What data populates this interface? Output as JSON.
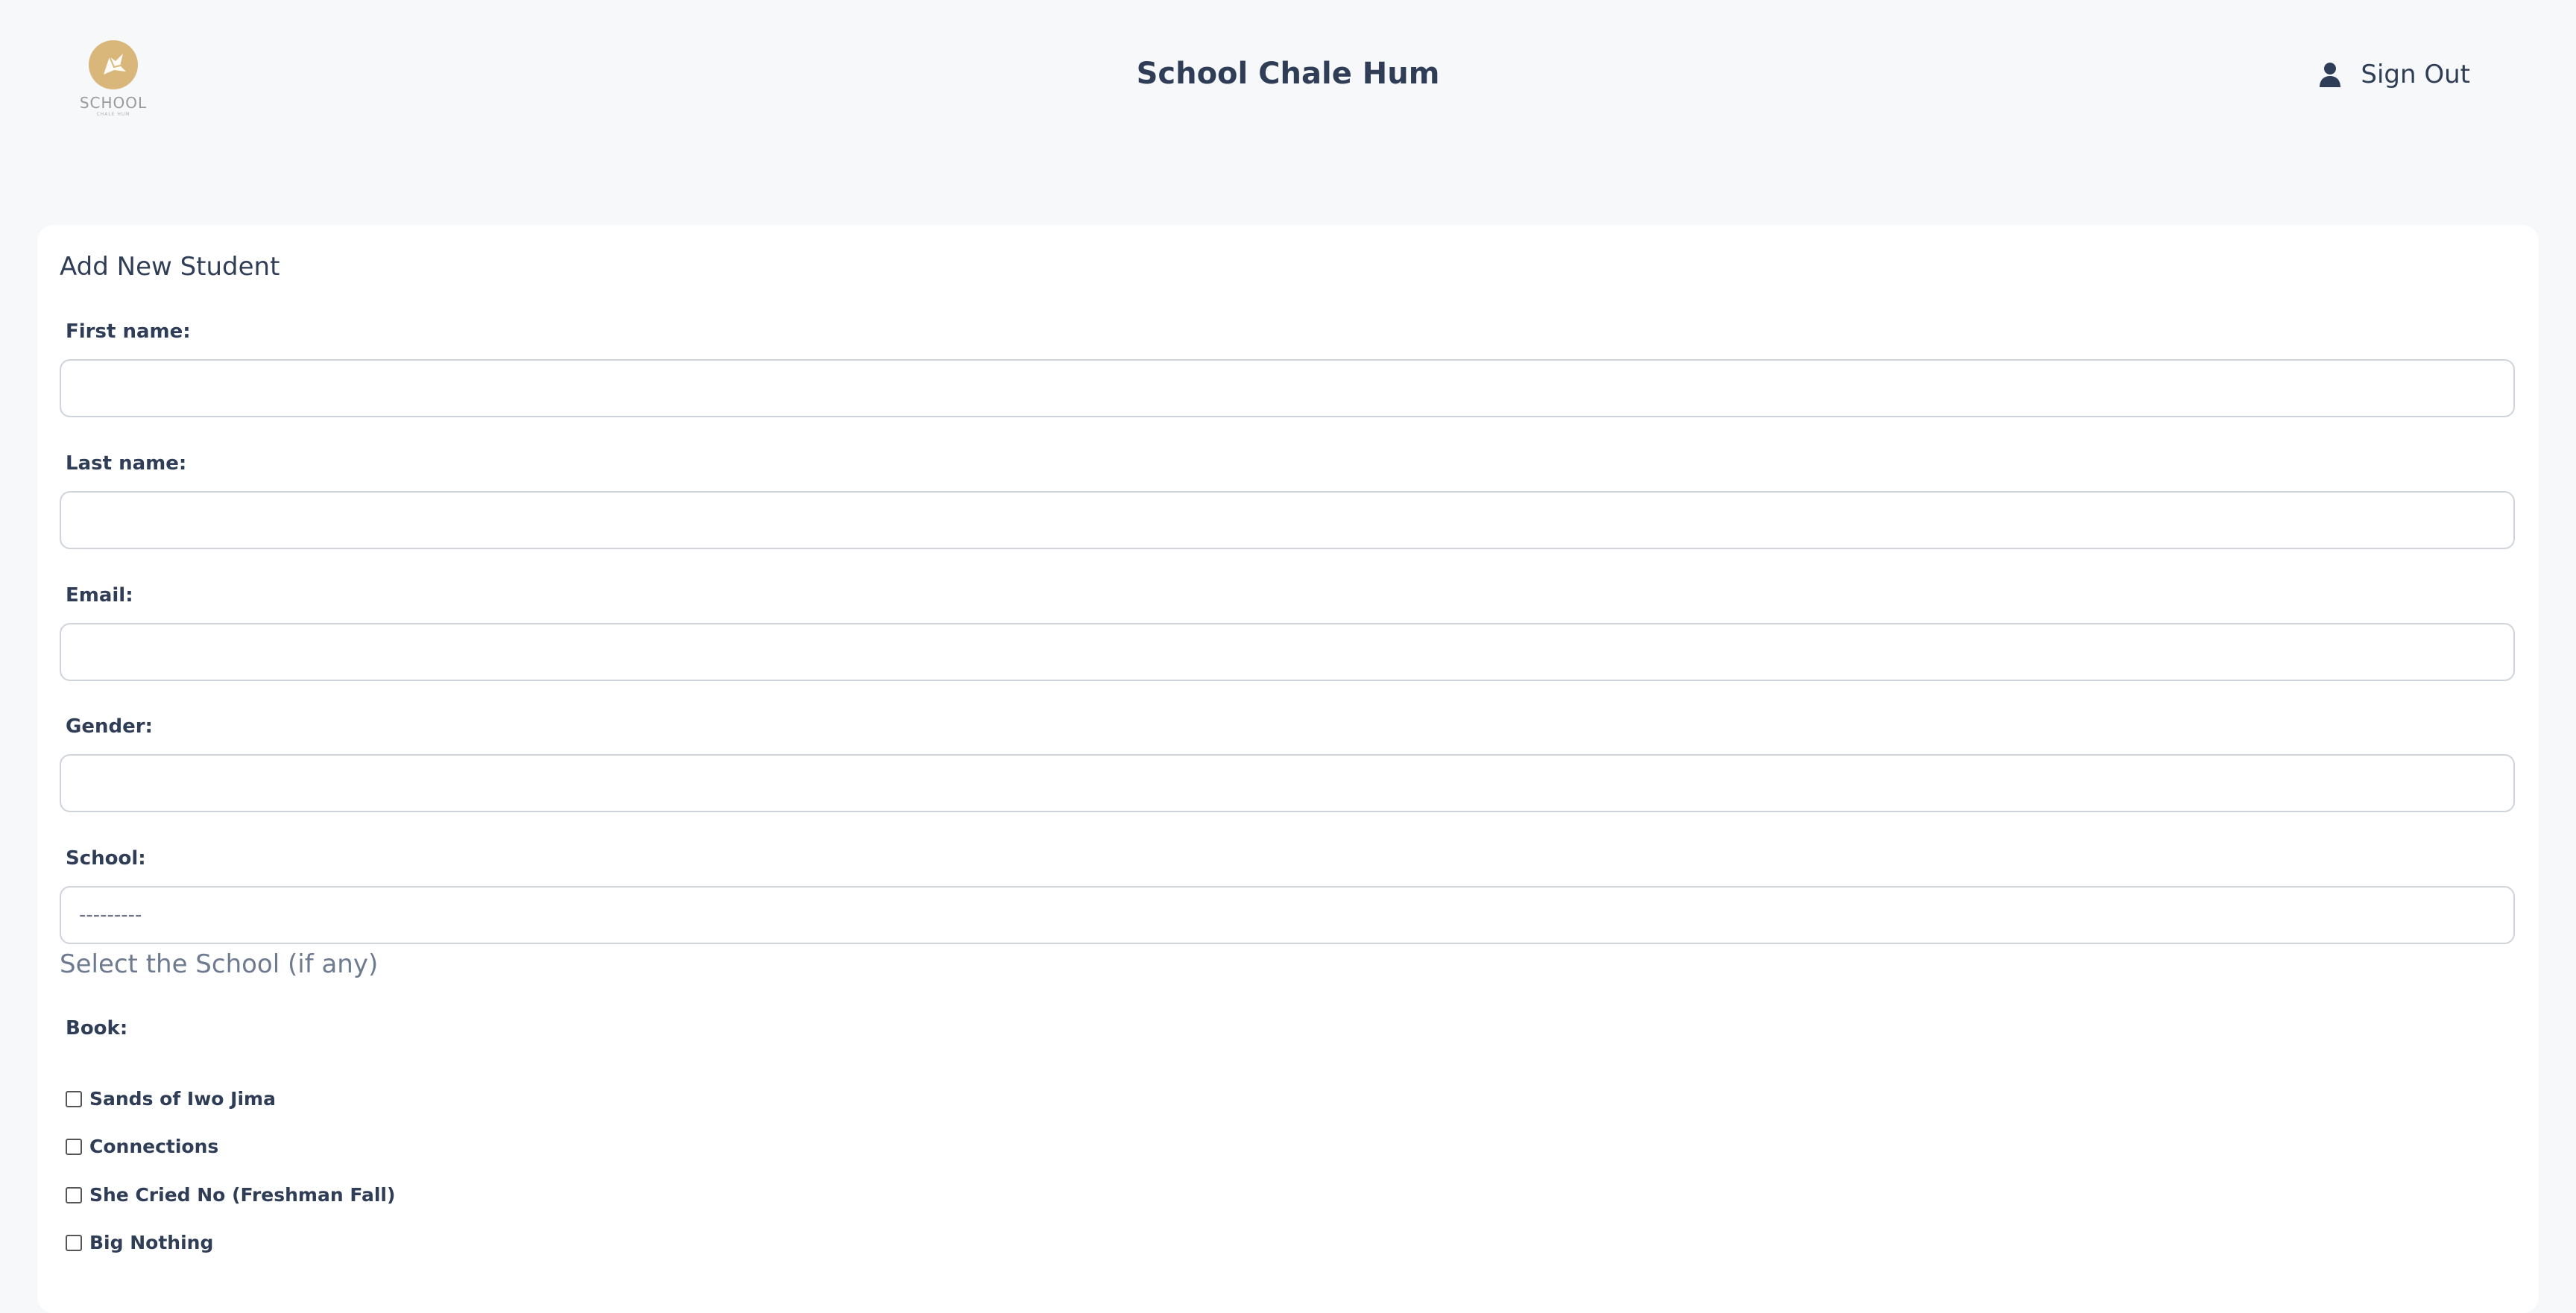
{
  "app": {
    "title": "School Chale Hum",
    "logo_text": "SCHOOL",
    "logo_subtext": "CHALE HUM",
    "signout_label": "Sign Out",
    "signout_icon": "user-icon"
  },
  "form": {
    "title": "Add New Student",
    "fields": {
      "first_name": {
        "label": "First name:",
        "value": ""
      },
      "last_name": {
        "label": "Last name:",
        "value": ""
      },
      "email": {
        "label": "Email:",
        "value": ""
      },
      "gender": {
        "label": "Gender:",
        "value": ""
      },
      "school": {
        "label": "School:",
        "selected": "---------",
        "help": "Select the School (if any)"
      }
    },
    "book_label": "Book:",
    "books": [
      {
        "label": "Sands of Iwo Jima",
        "checked": false
      },
      {
        "label": "Connections",
        "checked": false
      },
      {
        "label": "She Cried No (Freshman Fall)",
        "checked": false
      },
      {
        "label": "Big Nothing",
        "checked": false
      }
    ]
  },
  "colors": {
    "page_bg": "#f7f8fa",
    "card_bg": "#ffffff",
    "text": "#2f3e56",
    "border": "#cfd4da",
    "logo_gold": "#d9b77a"
  }
}
